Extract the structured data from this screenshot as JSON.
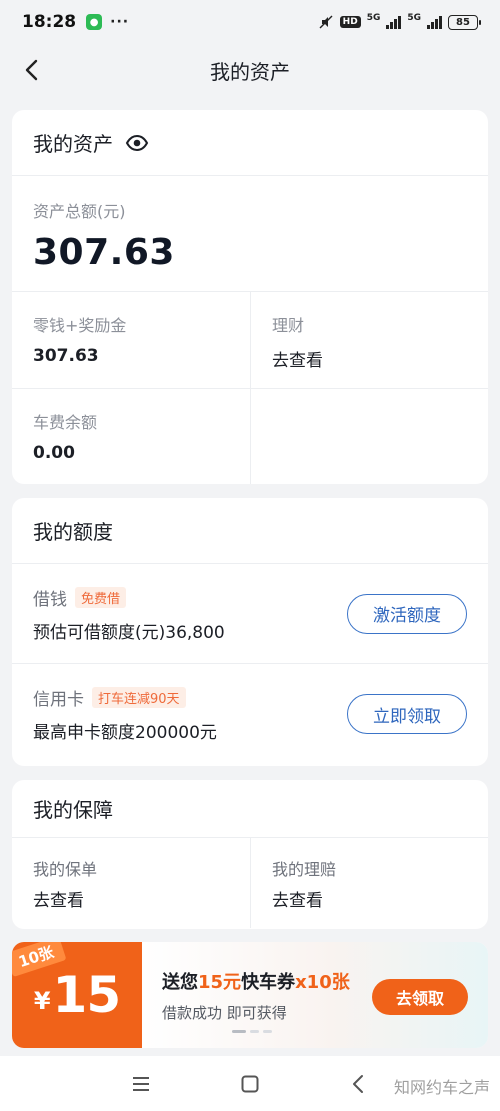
{
  "status_bar": {
    "time": "18:28",
    "more": "···",
    "hd": "HD",
    "network_1": "5G",
    "network_2": "5G",
    "battery": "85"
  },
  "header": {
    "title": "我的资产"
  },
  "assets": {
    "title": "我的资产",
    "total_label": "资产总额(元)",
    "total_value": "307.63",
    "change_label": "零钱+奖励金",
    "change_value": "307.63",
    "wealth_label": "理财",
    "wealth_value": "去查看",
    "fare_label": "车费余额",
    "fare_value": "0.00"
  },
  "quota": {
    "title": "我的额度",
    "loan_label": "借钱",
    "loan_tag": "免费借",
    "loan_desc": "预估可借额度(元)36,800",
    "loan_button": "激活额度",
    "card_label": "信用卡",
    "card_tag": "打车连减90天",
    "card_desc": "最高申卡额度200000元",
    "card_button": "立即领取"
  },
  "protection": {
    "title": "我的保障",
    "policy_label": "我的保单",
    "policy_value": "去查看",
    "claim_label": "我的理赔",
    "claim_value": "去查看"
  },
  "banner": {
    "ribbon": "10张",
    "yen": "¥",
    "amount": "15",
    "title_pre": "送您",
    "title_hl": "15元",
    "title_mid": "快车券",
    "title_hl2": "x10张",
    "subtitle": "借款成功 即可获得",
    "button": "去领取"
  },
  "watermark": "知网约车之声",
  "colors": {
    "accent_blue": "#2e66bd",
    "accent_orange": "#f06219",
    "tag_bg": "#fdeee6"
  }
}
